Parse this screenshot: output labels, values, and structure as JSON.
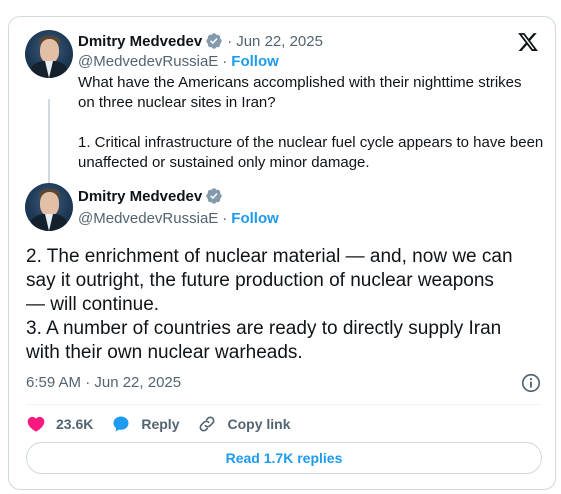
{
  "parent_tweet": {
    "author_name": "Dmitry Medvedev",
    "handle": "@MedvedevRussiaE",
    "separator": "·",
    "date": "Jun 22, 2025",
    "follow_label": "Follow",
    "text_line1": "What have the Americans accomplished with their nighttime strikes",
    "text_line2": "on three nuclear sites in Iran?",
    "text_line3": "1. Critical infrastructure of the nuclear fuel cycle appears to have been",
    "text_line4": "unaffected or sustained only minor damage."
  },
  "main_tweet": {
    "author_name": "Dmitry Medvedev",
    "handle": "@MedvedevRussiaE",
    "separator": "·",
    "follow_label": "Follow",
    "text_line1": "2. The enrichment of nuclear material — and, now we can",
    "text_line2": "say it outright, the future production of nuclear weapons",
    "text_line3": "— will continue.",
    "text_line4": "3. A number of countries are ready to directly supply Iran",
    "text_line5": "with their own nuclear warheads.",
    "timestamp": "6:59 AM · Jun 22, 2025"
  },
  "actions": {
    "like_count": "23.6K",
    "reply_label": "Reply",
    "copy_link_label": "Copy link"
  },
  "read_replies_label": "Read 1.7K replies",
  "icons": {
    "logo": "x-logo-icon",
    "verified": "verified-badge-icon",
    "like": "heart-icon",
    "reply": "speech-bubble-icon",
    "copy": "link-icon",
    "info": "info-icon"
  },
  "colors": {
    "accent": "#1d9bf0",
    "like": "#f91880",
    "muted": "#536471",
    "verified_badge": "#829aab"
  }
}
